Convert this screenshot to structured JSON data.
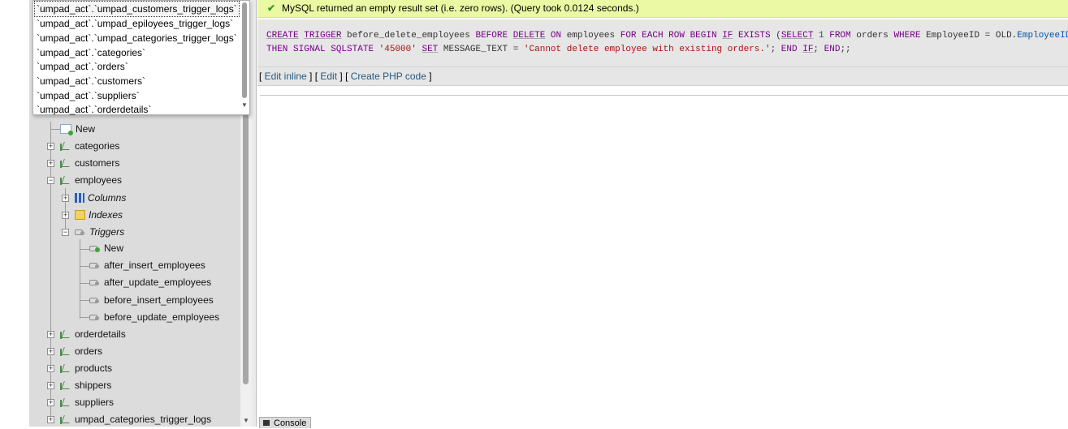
{
  "recent_tables": {
    "items": [
      "`umpad_act`.`umpad_customers_trigger_logs`",
      "`umpad_act`.`umpad_epiloyees_trigger_logs`",
      "`umpad_act`.`umpad_categories_trigger_logs`",
      "`umpad_act`.`categories`",
      "`umpad_act`.`orders`",
      "`umpad_act`.`customers`",
      "`umpad_act`.`suppliers`",
      "`umpad_act`.`orderdetails`"
    ]
  },
  "nav_tree": {
    "new_table": "New",
    "tables": {
      "categories": "categories",
      "customers": "customers",
      "employees": "employees",
      "orderdetails": "orderdetails",
      "orders": "orders",
      "products": "products",
      "shippers": "shippers",
      "suppliers": "suppliers",
      "umpad_categories_trigger_logs": "umpad_categories_trigger_logs"
    },
    "employees_children": {
      "columns": "Columns",
      "indexes": "Indexes",
      "triggers": "Triggers"
    },
    "triggers": {
      "new": "New",
      "items": [
        "after_insert_employees",
        "after_update_employees",
        "before_insert_employees",
        "before_update_employees"
      ]
    }
  },
  "message": {
    "text": "MySQL returned an empty result set (i.e. zero rows). (Query took 0.0124 seconds.)",
    "color": "#ebf8a4"
  },
  "sql": {
    "t": {
      "create": "CREATE",
      "trigger": "TRIGGER",
      "name": " before_delete_employees ",
      "before": "BEFORE",
      "delete": "DELETE",
      "on": "ON",
      "table": " employees ",
      "for_each_row": "FOR EACH ROW",
      "begin": "BEGIN",
      "if": "IF",
      "exists": "EXISTS",
      "paren_open": " (",
      "select": "SELECT",
      "one": " 1 ",
      "from": "FROM",
      "orders": " orders ",
      "where": "WHERE",
      "eid": " EmployeeID = OLD.",
      "eid2": "EmployeeID",
      "paren_close": ")",
      "then": "THEN",
      "signal": "SIGNAL",
      "sqlstate": "SQLSTATE",
      "state_val": "'45000'",
      "set": "SET",
      "message_text": " MESSAGE_TEXT = ",
      "message_val": "'Cannot delete employee with existing orders.'",
      "semi": ";",
      "end": "END",
      "tail": ";;"
    }
  },
  "links": {
    "edit_inline": "Edit inline",
    "edit": "Edit",
    "create_php": "Create PHP code"
  },
  "console": {
    "label": "Console"
  }
}
